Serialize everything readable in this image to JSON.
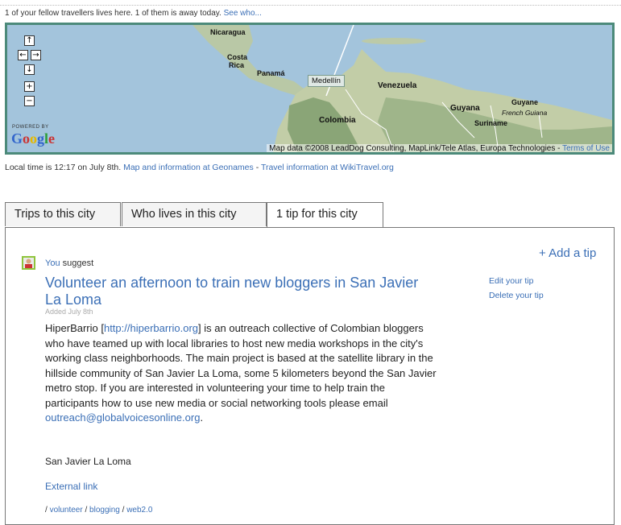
{
  "header": {
    "travellers_text": "1 of your fellow travellers lives here. 1 of them is away today.",
    "see_who_link": "See who..."
  },
  "map": {
    "places": {
      "nicaragua": "Nicaragua",
      "costa": "Costa",
      "rica": "Rica",
      "panama": "Panamá",
      "medellin": "Medellín",
      "venezuela": "Venezuela",
      "colombia": "Colombia",
      "guyana": "Guyana",
      "guyane": "Guyane",
      "french_guiana": "French Guiana",
      "suriname": "Suriname"
    },
    "controls": {
      "up": "↑",
      "left": "←",
      "right": "→",
      "down": "↓",
      "zoom_in": "+",
      "zoom_out": "−"
    },
    "powered_by": "POWERED BY",
    "google": "Google",
    "attribution": "Map data ©2008 LeadDog Consulting, MapLink/Tele Atlas, Europa Technologies -",
    "terms_link": "Terms of Use"
  },
  "local": {
    "time_text": "Local time is 12:17 on July 8th.",
    "geonames_link": "Map and information at Geonames",
    "separator": "-",
    "wikitravel_link": "Travel information at WikiTravel.org"
  },
  "tabs": [
    {
      "label": "Trips to this city",
      "active": false
    },
    {
      "label": "Who lives in this city",
      "active": false
    },
    {
      "label": "1 tip for this city",
      "active": true
    }
  ],
  "tip": {
    "author_link": "You",
    "suggest_text": "suggest",
    "title": "Volunteer an afternoon to train new bloggers in San Javier La Loma",
    "added": "Added July 8th",
    "description_before_link": "HiperBarrio [",
    "description_link": "http://hiperbarrio.org",
    "description_middle": "] is an outreach collective of Colombian bloggers who have teamed up with local libraries to host new media workshops in the city's working class neighborhoods. The main project is based at the satellite library in the hillside community of San Javier La Loma, some 5 kilometers beyond the San Javier metro stop. If you are interested in volunteering your time to help train the participants how to use new media or social networking tools please email ",
    "email_link": "outreach@globalvoicesonline.org",
    "description_end": ".",
    "place": "San Javier La Loma",
    "external_link": "External link",
    "tags": [
      "volunteer",
      "blogging",
      "web2.0"
    ],
    "tag_separator": "/"
  },
  "actions": {
    "add_tip": "+ Add a tip",
    "edit_tip": "Edit your tip",
    "delete_tip": "Delete your tip"
  },
  "colors": {
    "link": "#3b6fb6",
    "map_border": "#4c8a7a",
    "avatar_border": "#8fc43c"
  }
}
